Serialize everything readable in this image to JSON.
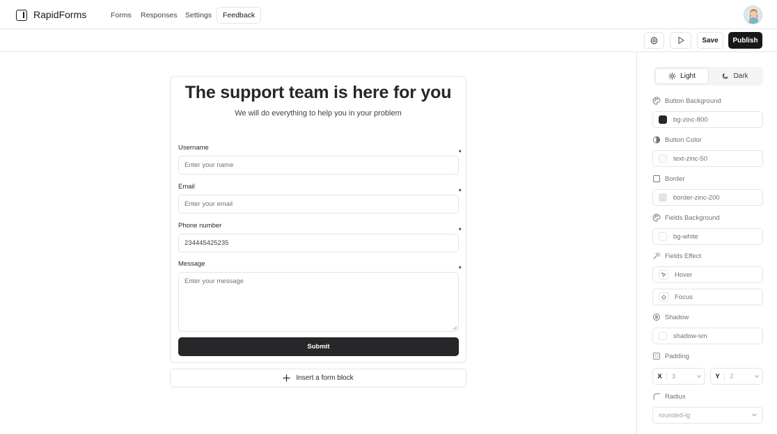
{
  "app": {
    "brand": "RapidForms",
    "nav": [
      {
        "label": "Forms"
      },
      {
        "label": "Responses"
      },
      {
        "label": "Settings"
      },
      {
        "label": "Feedback"
      }
    ]
  },
  "toolbar": {
    "save_label": "Save",
    "publish_label": "Publish"
  },
  "form": {
    "title": "The support team is here for you",
    "subtitle": "We will do everything to help you in your problem",
    "required_mark": "*",
    "fields": [
      {
        "label": "Username",
        "placeholder": "Enter your name",
        "value": ""
      },
      {
        "label": "Email",
        "placeholder": "Enter your email",
        "value": ""
      },
      {
        "label": "Phone number",
        "placeholder": "",
        "value": "234445425235"
      },
      {
        "label": "Message",
        "placeholder": "Enter your message",
        "value": ""
      }
    ],
    "submit_label": "Submit",
    "insert_block_label": "Insert a form block"
  },
  "panel": {
    "theme": {
      "light": "Light",
      "dark": "Dark",
      "selected": "Light"
    },
    "button_background": {
      "label": "Button Background",
      "value": "bg-zinc-800",
      "swatch": "#27272a"
    },
    "button_color": {
      "label": "Button Color",
      "value": "text-zinc-50",
      "swatch": "#fafafa"
    },
    "border": {
      "label": "Border",
      "value": "border-zinc-200",
      "swatch": "#e4e4e7"
    },
    "fields_background": {
      "label": "Fields Background",
      "value": "bg-white",
      "swatch": "#ffffff"
    },
    "fields_effect": {
      "label": "Fields Effect",
      "hover": "Hover",
      "focus": "Focus"
    },
    "shadow": {
      "label": "Shadow",
      "value": "shadow-sm",
      "swatch": "#ffffff"
    },
    "padding": {
      "label": "Padding",
      "x_axis": "X",
      "x_value": "3",
      "y_axis": "Y",
      "y_value": "2"
    },
    "radius": {
      "label": "Radius",
      "value": "rounded-lg"
    }
  },
  "colors": {
    "accent_dark": "#18181b",
    "border": "#e4e4e7",
    "muted_text": "#71717a"
  }
}
